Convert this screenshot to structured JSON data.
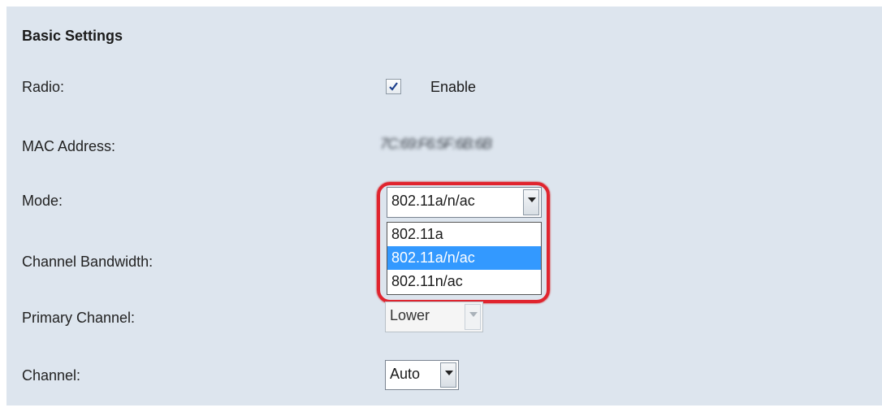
{
  "section": {
    "title": "Basic Settings"
  },
  "fields": {
    "radio": {
      "label": "Radio:",
      "checkbox_label": "Enable",
      "checked": true
    },
    "mac": {
      "label": "MAC Address:",
      "value": "7C:69:F6:5F:6B:6B"
    },
    "mode": {
      "label": "Mode:",
      "selected": "802.11a/n/ac",
      "options": [
        "802.11a",
        "802.11a/n/ac",
        "802.11n/ac"
      ],
      "highlighted_option": "802.11a/n/ac"
    },
    "channel_bandwidth": {
      "label": "Channel Bandwidth:"
    },
    "primary_channel": {
      "label": "Primary Channel:",
      "selected": "Lower",
      "disabled": true
    },
    "channel": {
      "label": "Channel:",
      "selected": "Auto"
    }
  },
  "colors": {
    "panel_bg": "#dde5ee",
    "highlight_border": "#e0242e",
    "selected_option_bg": "#3399ff"
  },
  "icons": {
    "checkbox": "check-icon",
    "dropdown_arrow": "chevron-down-icon"
  }
}
